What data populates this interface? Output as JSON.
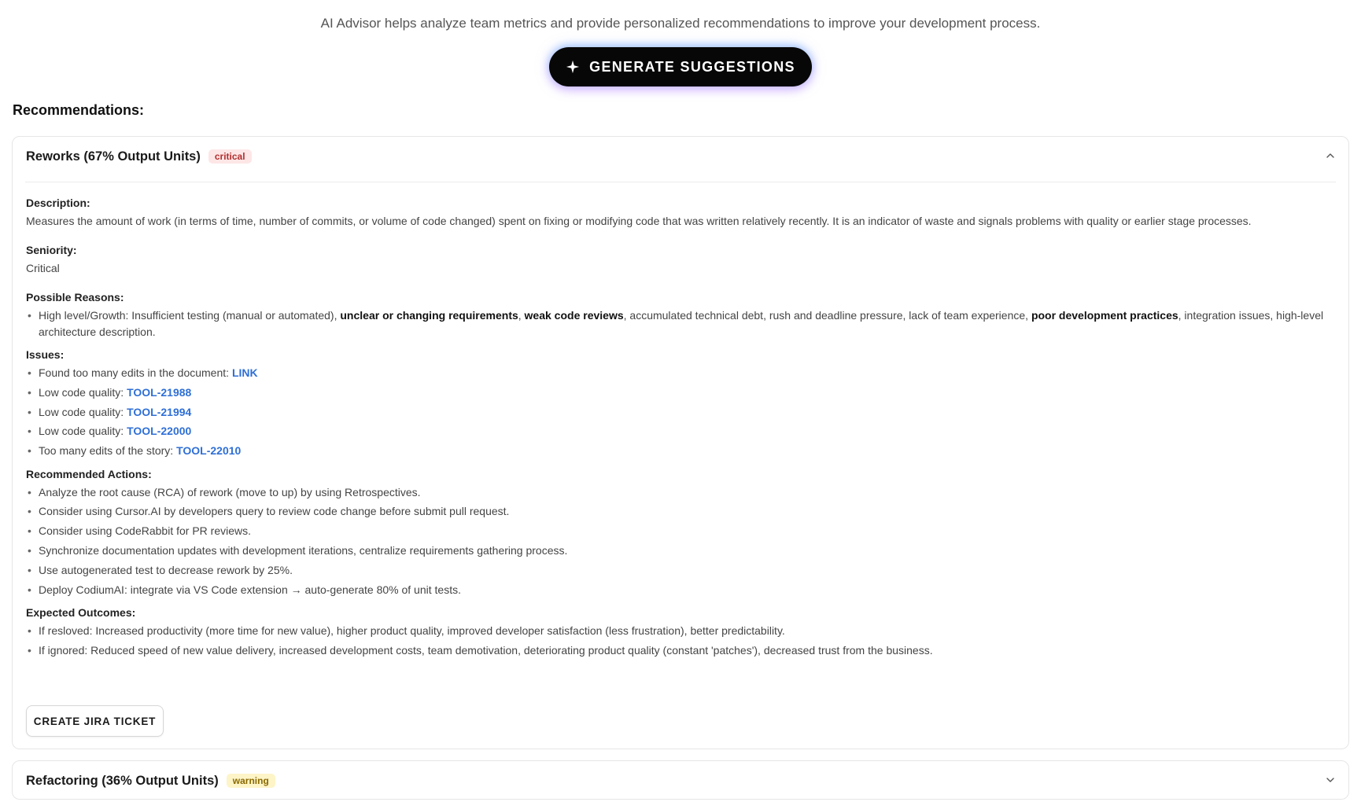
{
  "intro_text": "AI Advisor helps analyze team metrics and provide personalized recommendations to improve your development process.",
  "generate_button": {
    "label": "GENERATE SUGGESTIONS",
    "icon": "sparkle-icon"
  },
  "recommendations_title": "Recommendations:",
  "cards": [
    {
      "title": "Reworks (67% Output Units)",
      "badge": "critical",
      "expanded": true,
      "description_label": "Description:",
      "description": "Measures the amount of work (in terms of time, number of commits, or volume of code changed) spent on fixing or modifying code that was written relatively recently. It is an indicator of waste and signals problems with quality or earlier stage processes.",
      "seniority_label": "Seniority:",
      "seniority": "Critical",
      "reasons_label": "Possible Reasons:",
      "reason": {
        "p1": "High level/Growth: Insufficient testing (manual or automated), ",
        "b1": "unclear or changing requirements",
        "p2": ", ",
        "b2": "weak code reviews",
        "p3": ", accumulated technical debt, rush and deadline pressure, lack of team experience, ",
        "b3": "poor development practices",
        "p4": ", integration issues, high-level architecture description."
      },
      "issues_label": "Issues:",
      "issues": [
        {
          "text": "Found too many edits in the document: ",
          "link": "LINK"
        },
        {
          "text": "Low code quality: ",
          "link": "TOOL-21988"
        },
        {
          "text": "Low code quality: ",
          "link": "TOOL-21994"
        },
        {
          "text": "Low code quality: ",
          "link": "TOOL-22000"
        },
        {
          "text": "Too many edits of the story: ",
          "link": "TOOL-22010"
        }
      ],
      "actions_label": "Recommended Actions:",
      "actions": [
        "Analyze the root cause (RCA) of rework (move to up) by using Retrospectives.",
        "Consider using Cursor.AI by developers query to review code change before submit pull request.",
        "Consider using CodeRabbit for PR reviews.",
        "Synchronize documentation updates with development iterations, centralize requirements gathering process.",
        "Use autogenerated test to decrease rework by 25%.",
        "Deploy CodiumAI: integrate via VS Code extension → auto-generate 80% of unit tests."
      ],
      "outcomes_label": "Expected Outcomes:",
      "outcomes": [
        "If resloved: Increased productivity (more time for new value), higher product quality, improved developer satisfaction (less frustration), better predictability.",
        "If ignored: Reduced speed of new value delivery, increased development costs, team demotivation, deteriorating product quality (constant 'patches'), decreased trust from the business."
      ],
      "jira_button": "CREATE JIRA TICKET"
    },
    {
      "title": "Refactoring (36% Output Units)",
      "badge": "warning",
      "expanded": false
    }
  ],
  "colors": {
    "critical_badge_bg": "#fde6e6",
    "critical_badge_text": "#b03030",
    "warning_badge_bg": "#fdf4c8",
    "warning_badge_text": "#8a6a00",
    "link": "#2f6fd6"
  }
}
